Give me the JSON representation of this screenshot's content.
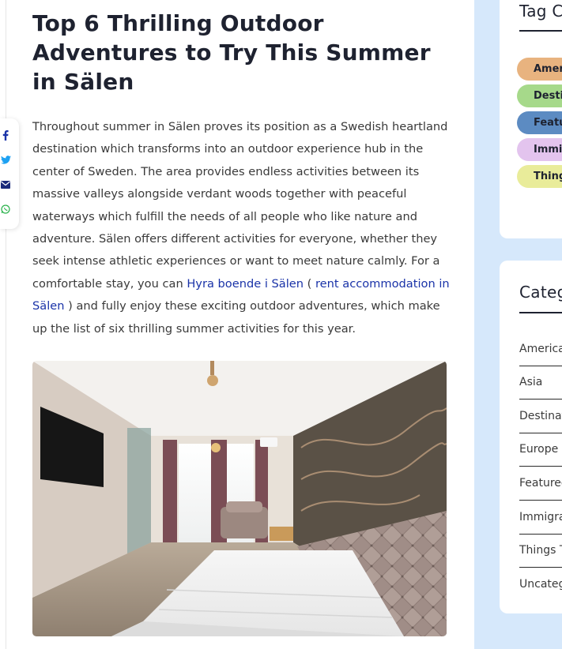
{
  "article": {
    "title": "Top 6 Thrilling Outdoor Adventures to Try This Summer in Sälen",
    "paragraph_before_link": "Throughout summer in Sälen proves its position as a Swedish heartland destination which transforms into an outdoor experience hub in the center of Sweden. The area provides endless activities between its massive valleys alongside verdant woods together with peaceful waterways which fulfill the needs of all people who like nature and adventure. Sälen offers different activities for everyone, whether they seek intense athletic experiences or want to meet nature calmly. For a comfortable stay, you can ",
    "link1_text": "Hyra boende i Sälen",
    "paren_open": " ( ",
    "link2_text": "rent accommodation in Sälen",
    "paragraph_after_link": " ) and fully enjoy these exciting outdoor adventures, which make up the list of six thrilling summer activities for this year."
  },
  "share": {
    "icons": [
      "facebook-icon",
      "twitter-icon",
      "email-icon",
      "whatsapp-icon"
    ]
  },
  "sidebar": {
    "tag_widget": {
      "title": "Tag C",
      "tags": [
        {
          "label": "Amer",
          "color": "#e8b37f"
        },
        {
          "label": "Destin",
          "color": "#a6d98a"
        },
        {
          "label": "Featu",
          "color": "#5c8bc2"
        },
        {
          "label": "Immig",
          "color": "#e3c4ee"
        },
        {
          "label": "Thing",
          "color": "#e9ec9a"
        }
      ]
    },
    "category_widget": {
      "title": "Categ",
      "items": [
        "America",
        "Asia",
        "Destinat",
        "Europe",
        "Featured",
        "Immigra",
        "Things T",
        "Uncateg"
      ]
    }
  },
  "colors": {
    "sidebar_bg": "#d6e8fb",
    "link": "#1a33a8",
    "heading": "#1e2230"
  }
}
